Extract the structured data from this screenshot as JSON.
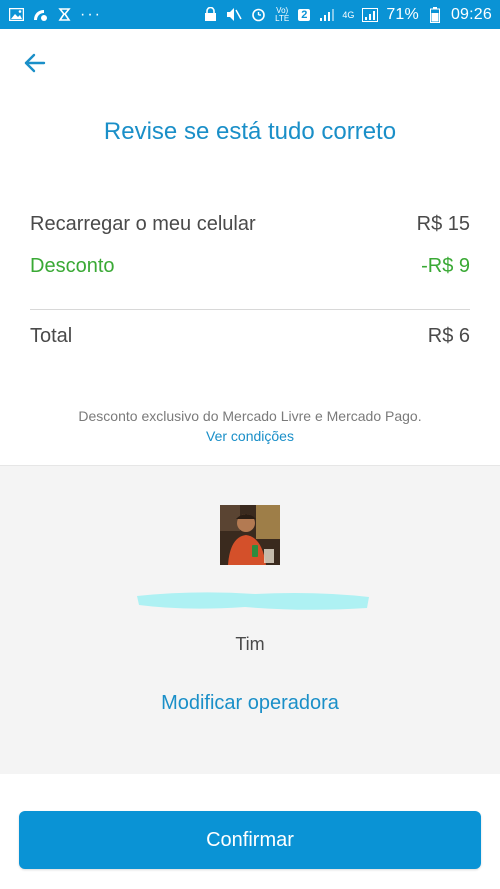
{
  "status_bar": {
    "dots": "···",
    "lte_label": "Vo) LTE",
    "sim_badge": "2",
    "network_label": "4G",
    "battery": "71%",
    "time": "09:26",
    "background_color": "#0a93d5"
  },
  "header": {
    "back_icon": "arrow-left-icon",
    "title": "Revise se está tudo correto"
  },
  "summary": {
    "items": [
      {
        "label": "Recarregar o meu celular",
        "value": "R$ 15"
      },
      {
        "label": "Desconto",
        "value": "-R$ 9"
      }
    ],
    "total_label": "Total",
    "total_value": "R$ 6"
  },
  "disclaimer": {
    "text": "Desconto exclusivo do Mercado Livre e Mercado Pago.",
    "link": "Ver condições"
  },
  "contact": {
    "photo_icon": "contact-photo",
    "operator": "Tim",
    "modify_link": "Modificar operadora"
  },
  "actions": {
    "confirm_label": "Confirmar"
  },
  "colors": {
    "primary": "#0a93d5",
    "link": "#1a8fc8",
    "discount": "#3aa935",
    "text": "#4a4a4a"
  }
}
